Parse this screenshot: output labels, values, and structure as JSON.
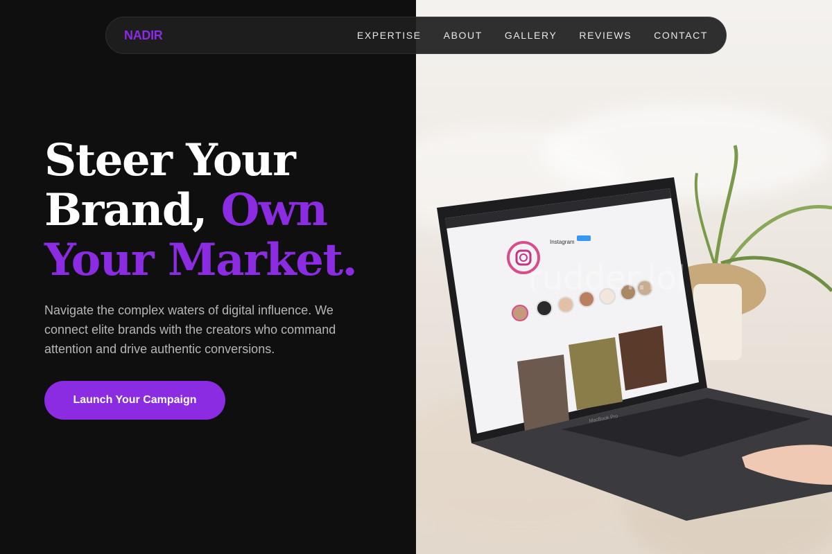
{
  "brand": {
    "name": "NADIR",
    "color": "#8b2be2"
  },
  "nav": {
    "links": [
      "EXPERTISE",
      "ABOUT",
      "GALLERY",
      "REVIEWS",
      "CONTACT"
    ]
  },
  "hero": {
    "headline_line1": "Steer Your",
    "headline_line2": "Brand,",
    "headline_accent_1": "Own",
    "headline_accent_2": "Your Market.",
    "subtext": "Navigate the complex waters of digital influence. We connect elite brands with the creators who command attention and drive authentic conversions.",
    "cta_label": "Launch Your Campaign"
  },
  "image": {
    "screen_app_name": "Instagram",
    "laptop_label": "MacBook Pro",
    "watermark": "rudder.lol"
  },
  "colors": {
    "accent": "#8b2be2",
    "background": "#0f0f10",
    "text": "#ffffff",
    "muted": "#b6b6b8"
  }
}
